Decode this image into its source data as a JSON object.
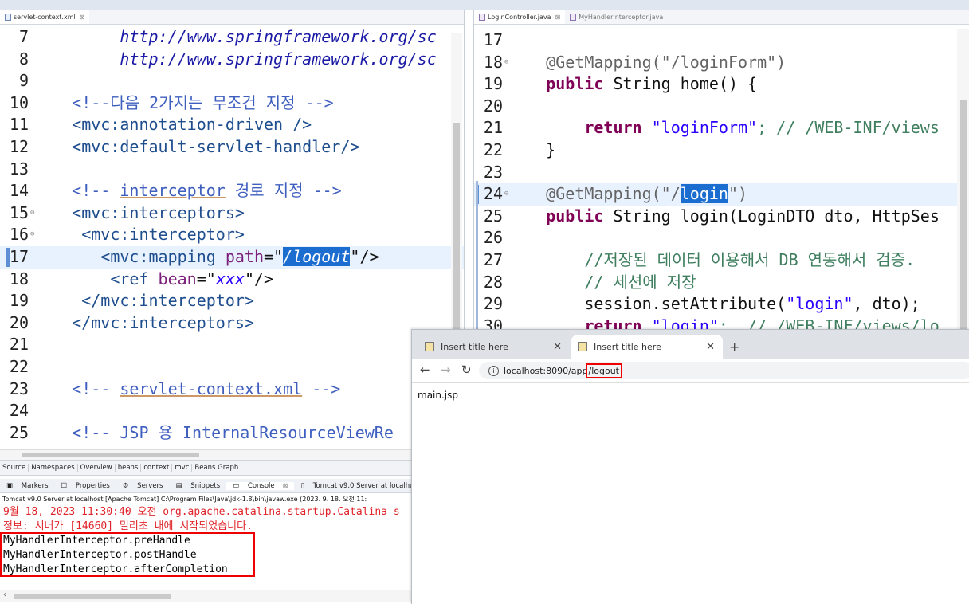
{
  "left_editor": {
    "tab": "servlet-context.xml",
    "lines": [
      {
        "n": "7"
      },
      {
        "n": "8"
      },
      {
        "n": "9"
      },
      {
        "n": "10"
      },
      {
        "n": "11"
      },
      {
        "n": "12"
      },
      {
        "n": "13"
      },
      {
        "n": "14"
      },
      {
        "n": "15"
      },
      {
        "n": "16"
      },
      {
        "n": "17"
      },
      {
        "n": "18"
      },
      {
        "n": "19"
      },
      {
        "n": "20"
      },
      {
        "n": "21"
      },
      {
        "n": "22"
      },
      {
        "n": "23"
      },
      {
        "n": "24"
      },
      {
        "n": "25"
      }
    ],
    "text": {
      "l7": "http://www.springframework.org/sc",
      "l8": "http://www.springframework.org/sc",
      "l10": "<!--다음 2가지는 무조건 지정 -->",
      "l11": "<mvc:annotation-driven />",
      "l12": "<mvc:default-servlet-handler/>",
      "l14a": "<!-- ",
      "l14b": "interceptor",
      "l14c": " 경로 지정 -->",
      "l15": "<mvc:interceptors>",
      "l16": "<mvc:interceptor>",
      "l17a": "<mvc:mapping ",
      "l17b": "path",
      "l17c": "=\"",
      "l17d": "/logout",
      "l17e": "\"/>",
      "l18a": "<ref ",
      "l18b": "bean",
      "l18c": "=\"",
      "l18d": "xxx",
      "l18e": "\"/>",
      "l19": "</mvc:interceptor>",
      "l20": "</mvc:interceptors>",
      "l23a": "<!-- ",
      "l23b": "servlet-context.xml",
      "l23c": " -->",
      "l25": "<!-- JSP 용 InternalResourceViewRe"
    },
    "bottom_tabs": [
      "Source",
      "Namespaces",
      "Overview",
      "beans",
      "context",
      "mvc",
      "Beans Graph"
    ]
  },
  "console": {
    "tabs": [
      "Markers",
      "Properties",
      "Servers",
      "Snippets",
      "Console",
      "Tomcat v9.0 Server at localhost"
    ],
    "header": "Tomcat v9.0 Server at localhost [Apache Tomcat] C:\\Program Files\\Java\\jdk-1.8\\bin\\javaw.exe  (2023. 9. 18. 오전 11:",
    "log_red_1": "9월 18, 2023 11:30:40 오전 org.apache.catalina.startup.Catalina s",
    "log_red_2": "정보: 서버가 [14660] 밀리초 내에 시작되었습니다.",
    "log_1": "MyHandlerInterceptor.preHandle",
    "log_2": "MyHandlerInterceptor.postHandle",
    "log_3": "MyHandlerInterceptor.afterCompletion"
  },
  "right_editor": {
    "tab_active": "LoginController.java",
    "tab_inactive": "MyHandlerInterceptor.java",
    "nums": [
      "17",
      "18",
      "19",
      "20",
      "21",
      "22",
      "23",
      "24",
      "25",
      "26",
      "27",
      "28",
      "29",
      "30"
    ],
    "text": {
      "l18a": "@GetMapping(\"/loginForm\")",
      "l19a": "public",
      "l19b": " String home() {",
      "l21a": "return",
      "l21b": " \"loginForm\"",
      "l21c": "; // /WEB-INF/views",
      "l22": "}",
      "l24a": "@GetMapping(\"/",
      "l24b": "login",
      "l24c": "\")",
      "l25a": "public",
      "l25b": " String login(LoginDTO dto, HttpSes",
      "l27": "//저장된 데이터 이용해서 DB 연동해서 검증.",
      "l28": "// 세션에 저장",
      "l29a": "session.setAttribute(",
      "l29b": "\"login\"",
      "l29c": ", dto);",
      "l30a": "return",
      "l30b": " \"login\"",
      "l30c": ";  // /WEB-INF/views/lo"
    }
  },
  "browser": {
    "tab1": "Insert title here",
    "tab2": "Insert title here",
    "url_prefix": "localhost:8090/app",
    "url_path": "/logout",
    "body_text": "main.jsp"
  }
}
